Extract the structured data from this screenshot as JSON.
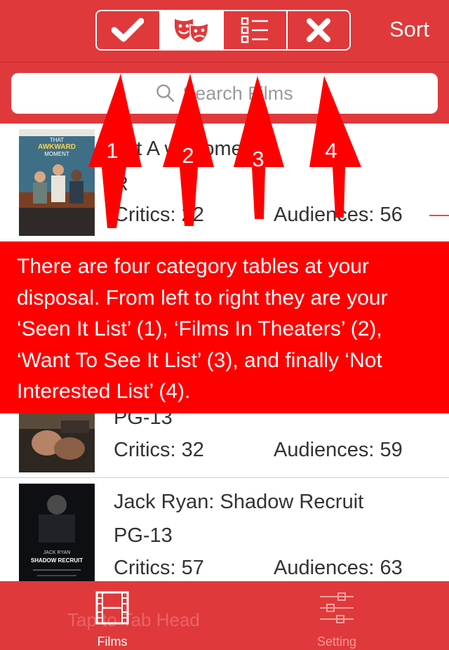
{
  "nav": {
    "segments": [
      {
        "icon": "checkmark-icon",
        "active": false
      },
      {
        "icon": "theater-masks-icon",
        "active": true
      },
      {
        "icon": "list-icon",
        "active": false
      },
      {
        "icon": "x-icon",
        "active": false
      }
    ],
    "sort_label": "Sort"
  },
  "search": {
    "placeholder": "Search Films"
  },
  "films": [
    {
      "title": "That Awkward Moment",
      "title_visible": "hat A  war   ome",
      "rating": "R",
      "critics": "Critics: 22",
      "audiences": "Audiences: 56"
    },
    {
      "title": "",
      "rating": "PG-13",
      "critics": "Critics: 32",
      "audiences": "Audiences: 59"
    },
    {
      "title": "Jack Ryan: Shadow Recruit",
      "rating": "PG-13",
      "critics": "Critics: 57",
      "audiences": "Audiences: 63"
    }
  ],
  "posters": {
    "awkward": "THAT AWKWARD MOMENT",
    "jackryan": "JACK RYAN SHADOW RECRUIT"
  },
  "tutorial": {
    "arrow_labels": [
      "1",
      "2",
      "3",
      "4"
    ],
    "banner_text": "There are four category tables at your disposal. From left to right they are your ‘Seen It List’ (1), ‘Films In Theaters’ (2), ‘Want To See It List’ (3), and finally ‘Not Interested List’ (4)."
  },
  "tabbar": {
    "tabs": [
      {
        "label": "Films",
        "icon": "film-strip-icon",
        "active": true
      },
      {
        "label": "Setting",
        "icon": "sliders-icon",
        "active": false
      }
    ],
    "ghost_text": "Tap to Tab Head"
  },
  "colors": {
    "accent": "#e0393b",
    "banner": "#ff0000",
    "arrow": "#ff0000"
  }
}
